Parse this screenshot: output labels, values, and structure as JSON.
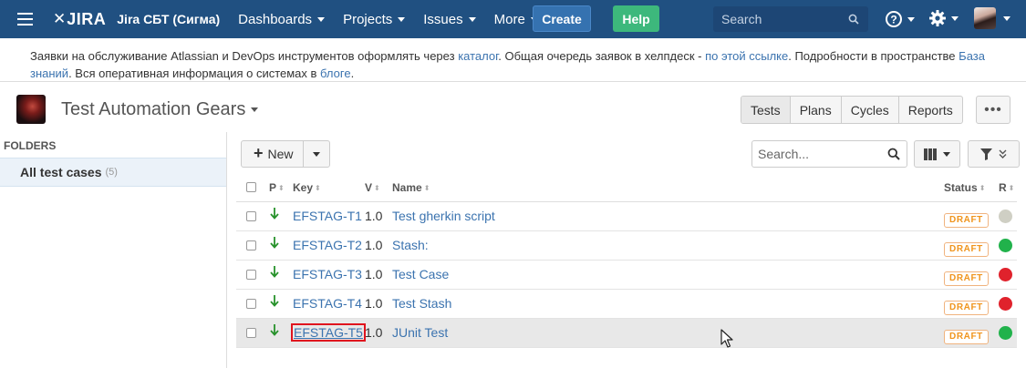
{
  "nav": {
    "site_name": "Jira СБТ (Сигма)",
    "logo_text": "JIRA",
    "menus": [
      "Dashboards",
      "Projects",
      "Issues",
      "More"
    ],
    "create_label": "Create",
    "help_label": "Help",
    "search_placeholder": "Search",
    "colors": {
      "bar": "#205081",
      "create": "#3572b0",
      "help": "#3db87c"
    }
  },
  "banner": {
    "t1": "Заявки на обслуживание Atlassian и DevOps инструментов оформлять через ",
    "l1": "каталог",
    "t2": ". Общая очередь заявок в хелпдеск - ",
    "l2": "по этой ссылке",
    "t3": ". Подробности в пространстве ",
    "l3": "База знаний",
    "t4": ". Вся оперативная информация о системах в ",
    "l4": "блоге",
    "t5": "."
  },
  "project": {
    "title": "Test Automation Gears",
    "tabs": [
      "Tests",
      "Plans",
      "Cycles",
      "Reports"
    ],
    "active_tab": "Tests",
    "more_label": "•••"
  },
  "folders": {
    "heading": "FOLDERS",
    "selected": {
      "name": "All test cases",
      "count": "(5)"
    }
  },
  "toolbar": {
    "new_label": "New",
    "search_placeholder": "Search..."
  },
  "table": {
    "headers": {
      "priority": "P",
      "key": "Key",
      "version": "V",
      "name": "Name",
      "status": "Status",
      "result": "R"
    },
    "rows": [
      {
        "key": "EFSTAG-T1",
        "version": "1.0",
        "name": "Test gherkin script",
        "status": "DRAFT",
        "result_color": "#cfcfc4"
      },
      {
        "key": "EFSTAG-T2",
        "version": "1.0",
        "name": "Stash:",
        "status": "DRAFT",
        "result_color": "#21b24b"
      },
      {
        "key": "EFSTAG-T3",
        "version": "1.0",
        "name": "Test Case",
        "status": "DRAFT",
        "result_color": "#e0222c"
      },
      {
        "key": "EFSTAG-T4",
        "version": "1.0",
        "name": "Test Stash",
        "status": "DRAFT",
        "result_color": "#e0222c"
      },
      {
        "key": "EFSTAG-T5",
        "version": "1.0",
        "name": "JUnit Test",
        "status": "DRAFT",
        "result_color": "#21b24b"
      }
    ],
    "priority_icon": "arrow-down-icon",
    "priority_color": "#27922b"
  }
}
